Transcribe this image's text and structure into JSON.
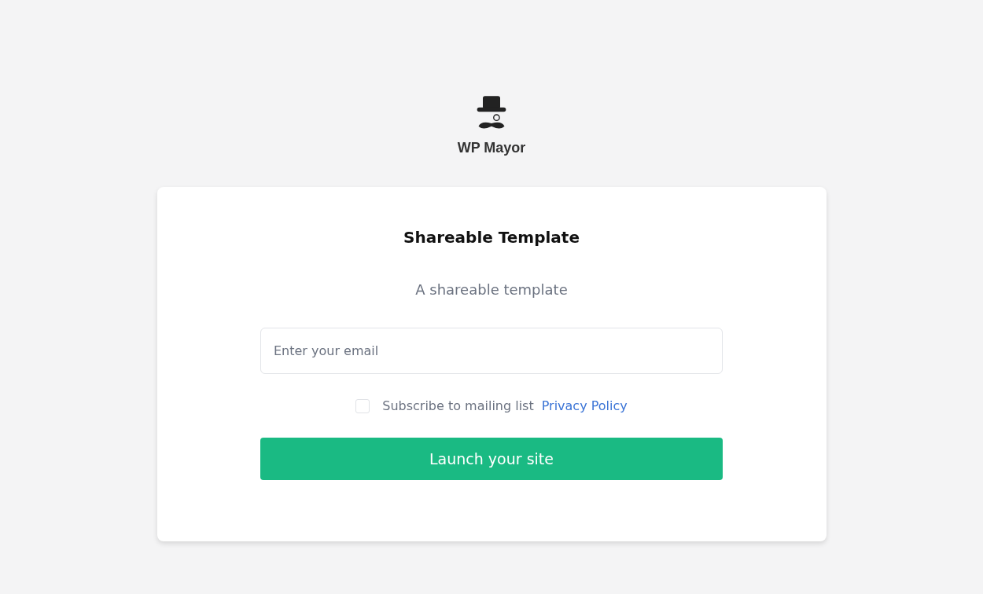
{
  "brand": {
    "name": "WP Mayor"
  },
  "card": {
    "title": "Shareable Template",
    "subtitle": "A shareable template",
    "email": {
      "placeholder": "Enter your email"
    },
    "subscribe": {
      "label": "Subscribe to mailing list",
      "checked": false,
      "link": "Privacy Policy"
    },
    "button": "Launch your site"
  }
}
